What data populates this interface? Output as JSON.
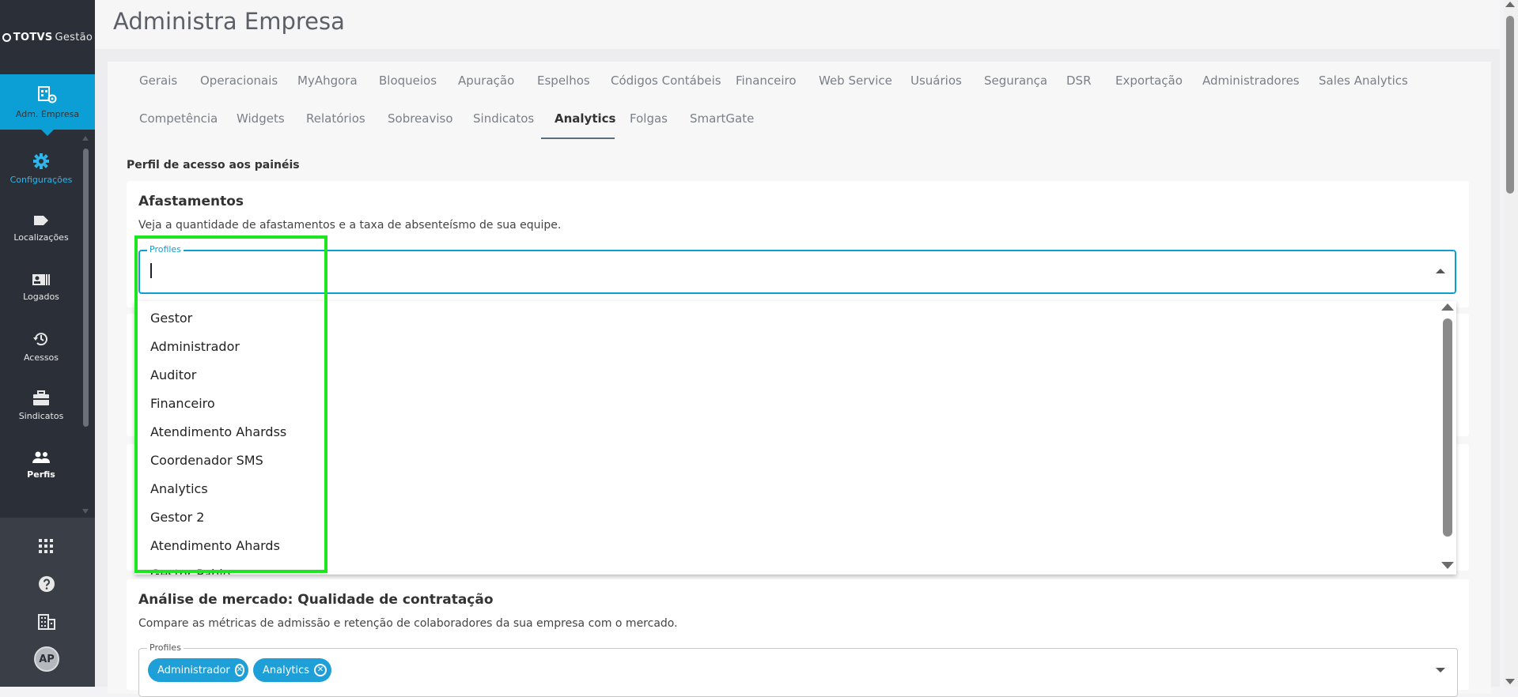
{
  "app": {
    "logo_brand": "TOTVS",
    "logo_product": "Gestão"
  },
  "sidebar": {
    "active": {
      "label": "Adm. Empresa",
      "icon": "company-admin-icon"
    },
    "items": [
      {
        "label": "Configurações",
        "icon": "gear-icon"
      },
      {
        "label": "Localizações",
        "icon": "tag-icon"
      },
      {
        "label": "Logados",
        "icon": "id-card-icon"
      },
      {
        "label": "Acessos",
        "icon": "history-icon"
      },
      {
        "label": "Sindicatos",
        "icon": "briefcase-icon"
      },
      {
        "label": "Perfis",
        "icon": "users-icon"
      }
    ],
    "bottom_icons": [
      "apps-grid-icon",
      "help-icon",
      "building-icon"
    ],
    "avatar_initials": "AP",
    "accent_color": "#0c9fd6"
  },
  "header": {
    "title": "Administra Empresa"
  },
  "tabs": {
    "row1": [
      "Gerais",
      "Operacionais",
      "MyAhgora",
      "Bloqueios",
      "Apuração",
      "Espelhos",
      "Códigos Contábeis",
      "Financeiro",
      "Web Service",
      "Usuários",
      "Segurança",
      "DSR",
      "Exportação",
      "Administradores",
      "Sales Analytics"
    ],
    "row2": [
      "Competência",
      "Widgets",
      "Relatórios",
      "Sobreaviso",
      "Sindicatos",
      "Analytics",
      "Folgas",
      "SmartGate"
    ],
    "active": "Analytics"
  },
  "section": {
    "label": "Perfil de acesso aos painéis"
  },
  "card_afastamentos": {
    "title": "Afastamentos",
    "description": "Veja a quantidade de afastamentos e a taxa de absenteísmo de sua equipe.",
    "field_label": "Profiles",
    "field_value": ""
  },
  "dropdown": {
    "options": [
      "Gestor",
      "Administrador",
      "Auditor",
      "Financeiro",
      "Atendimento Ahardss",
      "Coordenador SMS",
      "Analytics",
      "Gestor 2",
      "Atendimento Ahards",
      "Gestor Pablo"
    ]
  },
  "card_mercado": {
    "title": "Análise de mercado: Qualidade de contratação",
    "description": "Compare as métricas de admissão e retenção de colaboradores da sua empresa com o mercado.",
    "field_label": "Profiles",
    "chips": [
      "Administrador",
      "Analytics"
    ]
  }
}
